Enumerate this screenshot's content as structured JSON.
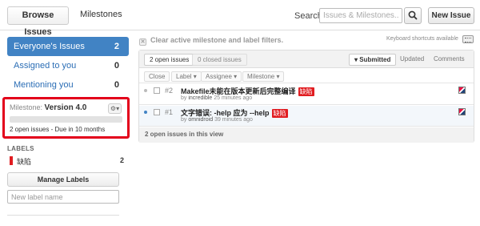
{
  "header": {
    "tabs": [
      {
        "label": "Browse Issues",
        "active": true
      },
      {
        "label": "Milestones",
        "active": false
      }
    ],
    "search_label": "Search:",
    "search_placeholder": "Issues & Milestones...",
    "search_icon": "magnifier-icon",
    "new_issue_label": "New Issue"
  },
  "sidebar": {
    "filters": [
      {
        "label": "Everyone's Issues",
        "count": "2",
        "active": true
      },
      {
        "label": "Assigned to you",
        "count": "0",
        "active": false
      },
      {
        "label": "Mentioning you",
        "count": "0",
        "active": false
      }
    ],
    "milestone": {
      "prefix": "Milestone:",
      "name": "Version 4.0",
      "gear_icon": "gear-icon",
      "progress_fraction": 0,
      "open_issues": "2 open issues",
      "separator": " - ",
      "due": "Due in 10 months",
      "highlight_color": "#e3001b"
    },
    "labels_heading": "LABELS",
    "labels": [
      {
        "name": "缺陷",
        "count": "2",
        "color": "#e11d21"
      }
    ],
    "manage_labels_label": "Manage Labels",
    "new_label_placeholder": "New label name"
  },
  "main": {
    "clear_filters": "Clear active milestone and label filters.",
    "keyboard_hint": "Keyboard shortcuts available",
    "keyboard_icon": "keyboard-icon",
    "state_tabs": {
      "open": "2 open issues",
      "closed": "0 closed issues"
    },
    "sort": {
      "submitted": "▾ Submitted",
      "updated": "Updated",
      "comments": "Comments"
    },
    "actions": {
      "close": "Close",
      "label": "Label ▾",
      "assignee": "Assignee ▾",
      "milestone": "Milestone ▾"
    },
    "issues": [
      {
        "number": "#2",
        "title": "Makefile未能在版本更新后完整编译",
        "label": "缺陷",
        "by": "by",
        "author": "incredible",
        "time": "25 minutes ago"
      },
      {
        "number": "#1",
        "title": "文字错误: -help 应为 --help",
        "label": "缺陷",
        "by": "by",
        "author": "omnidroid",
        "time": "39 minutes ago"
      }
    ],
    "footer": "2 open issues in this view"
  },
  "colors": {
    "accent": "#4183c4",
    "label_red": "#e11d21",
    "highlight_red": "#e3001b"
  }
}
